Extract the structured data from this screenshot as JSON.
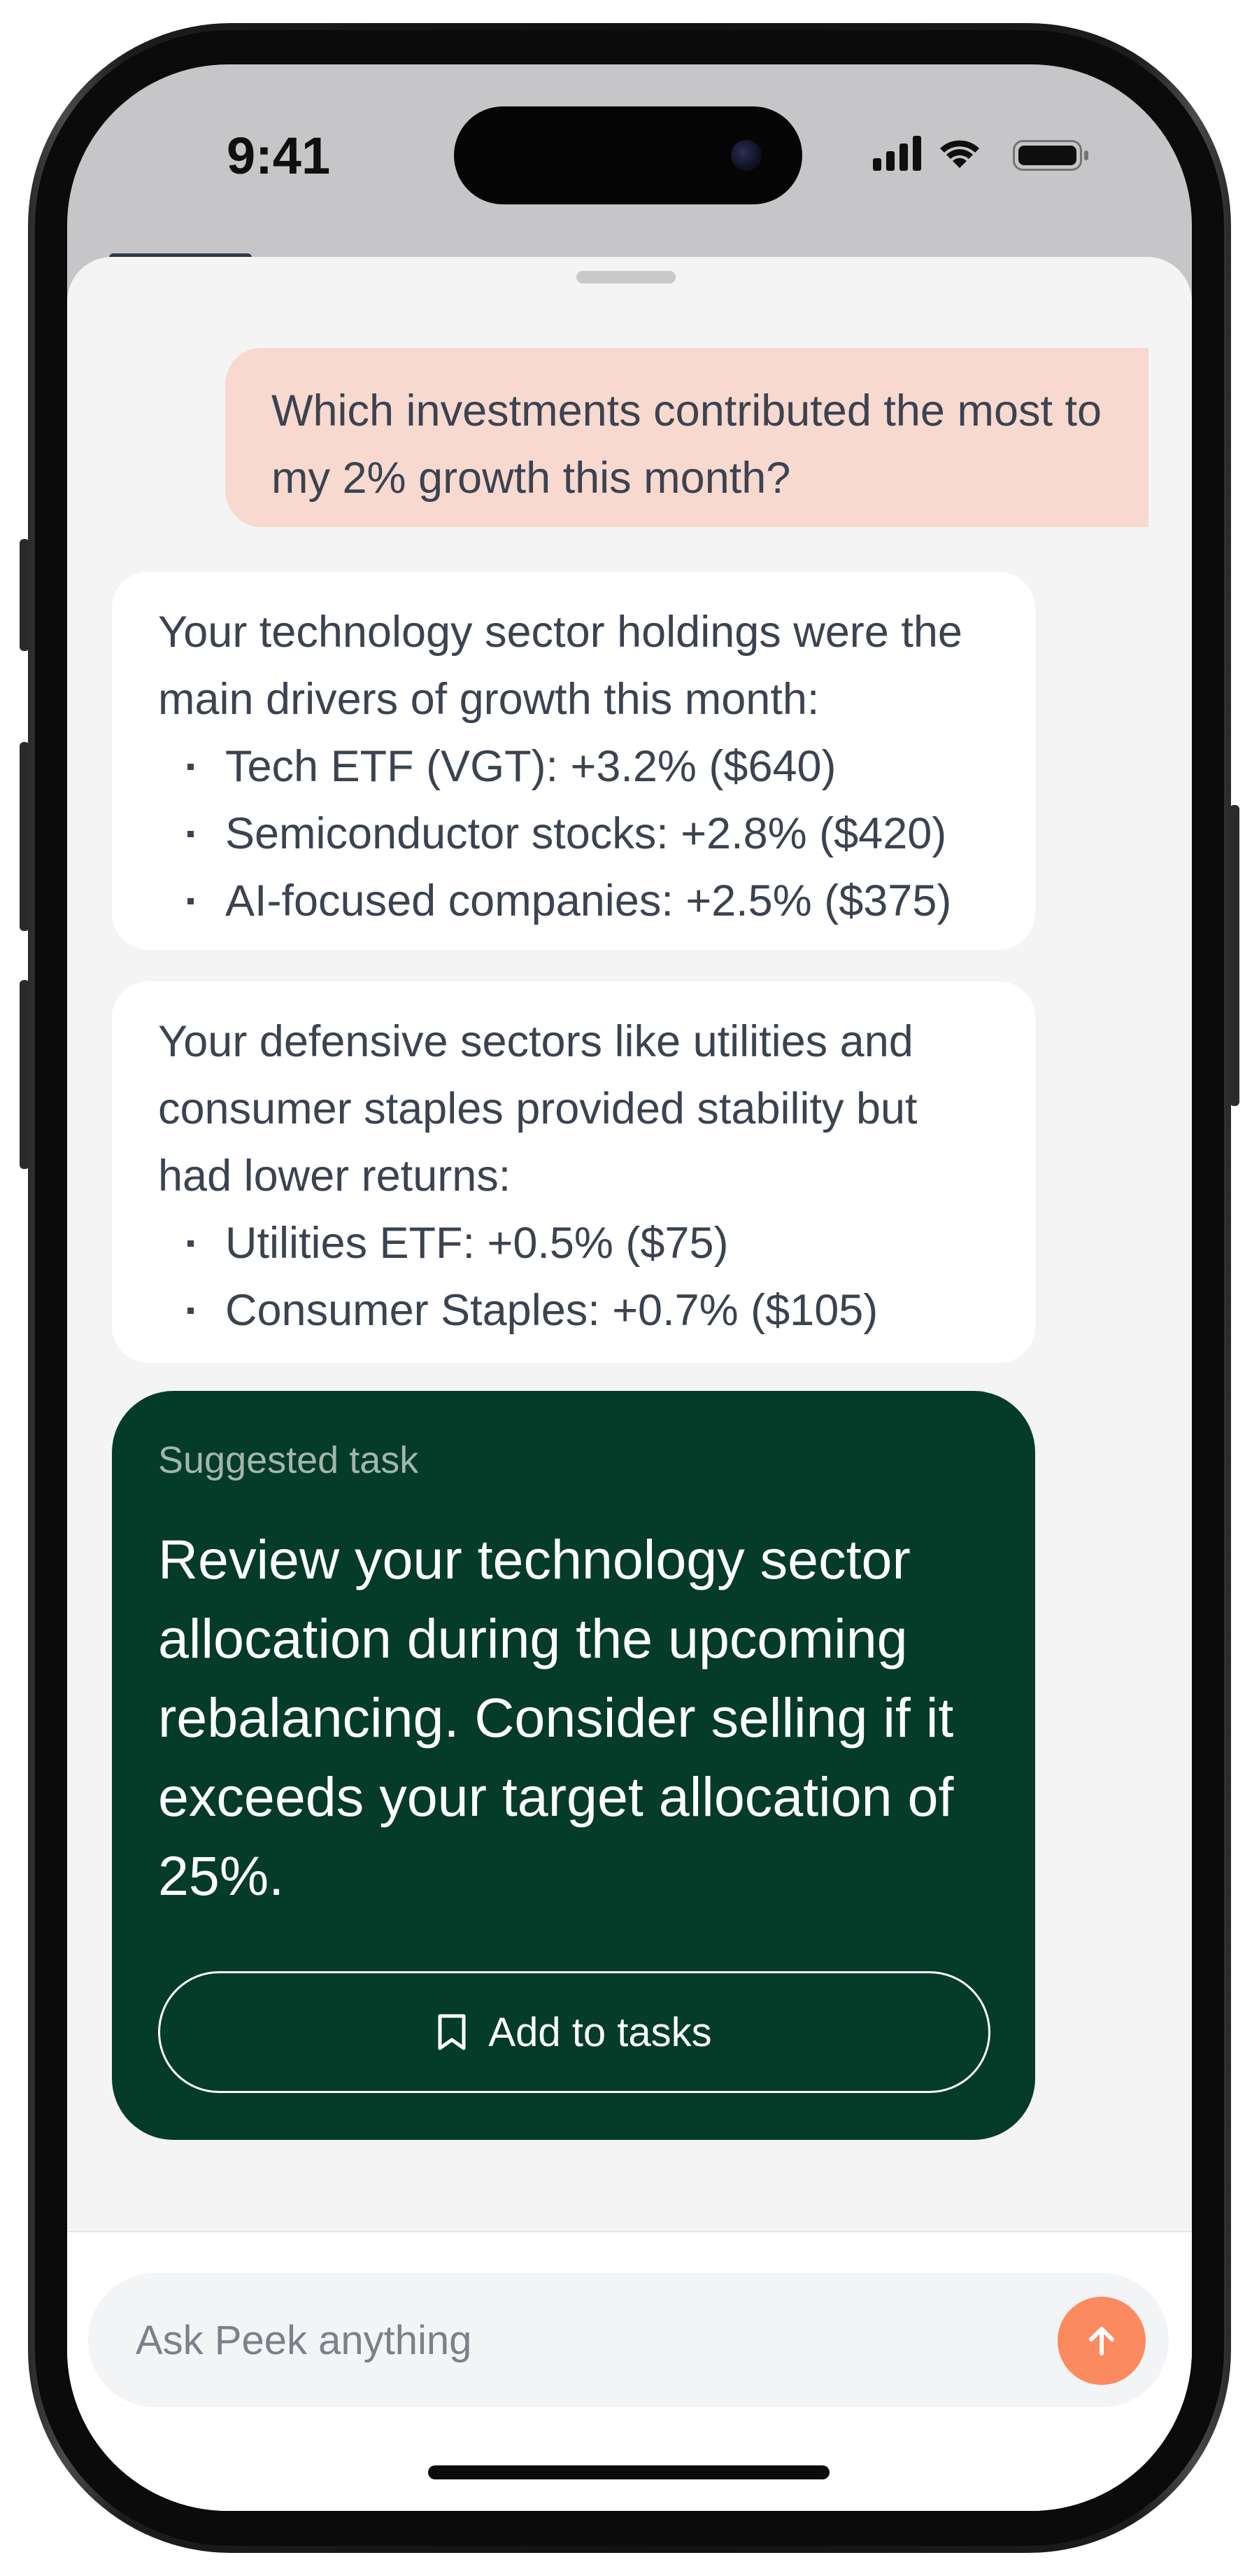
{
  "status_bar": {
    "time": "9:41",
    "icons": [
      "cellular-signal-icon",
      "wifi-icon",
      "battery-icon"
    ]
  },
  "chat": {
    "user_message": "Which investments contributed the most to my 2% growth this month?",
    "responses": [
      {
        "intro": "Your technology sector holdings were the main drivers of growth this month:",
        "items": [
          "Tech ETF (VGT): +3.2% ($640)",
          "Semiconductor stocks: +2.8% ($420)",
          "AI-focused companies: +2.5% ($375)"
        ]
      },
      {
        "intro": "Your defensive sectors like utilities and consumer staples provided stability but had lower returns:",
        "items": [
          "Utilities ETF: +0.5% ($75)",
          "Consumer Staples: +0.7% ($105)"
        ]
      }
    ],
    "suggested_task": {
      "kicker": "Suggested task",
      "body": "Review your technology sector allocation during the upcoming rebalancing. Consider selling if it exceeds your target allocation of 25%.",
      "button_label": "Add to tasks",
      "button_icon": "bookmark-icon"
    }
  },
  "composer": {
    "placeholder": "Ask Peek anything",
    "value": "",
    "send_icon": "arrow-up-icon"
  },
  "colors": {
    "user_bubble": "#f8d9cf",
    "task_card": "#043b29",
    "send_button": "#fb8a5e",
    "sheet_background": "#f4f4f5"
  }
}
